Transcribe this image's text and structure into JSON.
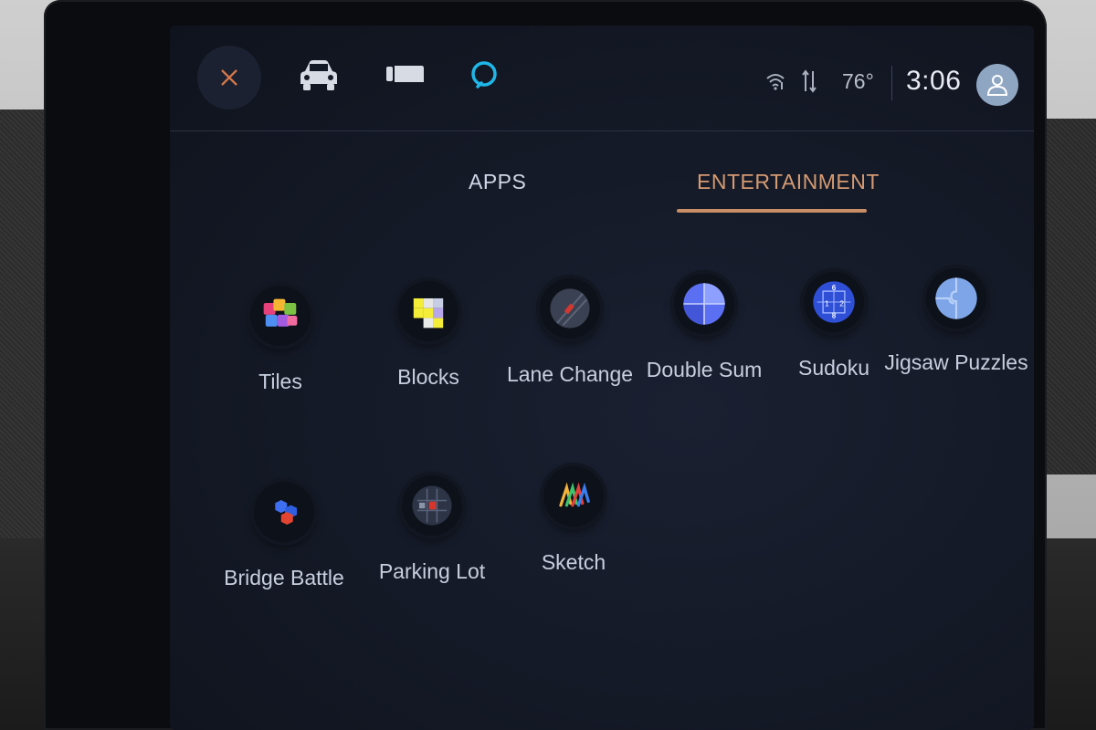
{
  "topbar": {
    "temperature": "76°",
    "time": "3:06"
  },
  "tabs": [
    {
      "label": "APPS",
      "active": false
    },
    {
      "label": "ENTERTAINMENT",
      "active": true
    }
  ],
  "apps": [
    {
      "label": "Tiles"
    },
    {
      "label": "Blocks"
    },
    {
      "label": "Lane Change"
    },
    {
      "label": "Double Sum"
    },
    {
      "label": "Sudoku"
    },
    {
      "label": "Jigsaw Puzzles"
    },
    {
      "label": "Bridge Battle"
    },
    {
      "label": "Parking Lot"
    },
    {
      "label": "Sketch"
    }
  ],
  "sudoku_icon_digits": [
    "6",
    "1",
    "2",
    "8"
  ],
  "colors": {
    "accent": "#c98e66",
    "alexa": "#1fb6e8",
    "screen_bg": "#141926"
  }
}
